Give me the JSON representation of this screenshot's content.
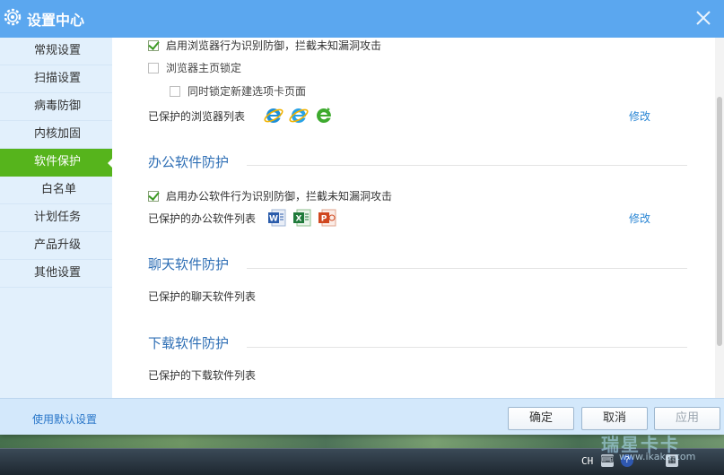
{
  "window": {
    "title": "设置中心"
  },
  "sidebar": {
    "items": [
      {
        "label": "常规设置",
        "active": false
      },
      {
        "label": "扫描设置",
        "active": false
      },
      {
        "label": "病毒防御",
        "active": false
      },
      {
        "label": "内核加固",
        "active": false
      },
      {
        "label": "软件保护",
        "active": true
      },
      {
        "label": "白名单",
        "active": false
      },
      {
        "label": "计划任务",
        "active": false
      },
      {
        "label": "产品升级",
        "active": false
      },
      {
        "label": "其他设置",
        "active": false
      }
    ]
  },
  "browser": {
    "enable_label": "启用浏览器行为识别防御，拦截未知漏洞攻击",
    "enable_checked": true,
    "homepage_lock_label": "浏览器主页锁定",
    "homepage_lock_checked": false,
    "newtab_lock_label": "同时锁定新建选项卡页面",
    "newtab_lock_checked": false,
    "protected_list_label": "已保护的浏览器列表",
    "edit_label": "修改",
    "icons": [
      "ie-icon",
      "ie-icon",
      "ie-green-icon"
    ]
  },
  "office": {
    "section_title": "办公软件防护",
    "enable_label": "启用办公软件行为识别防御，拦截未知漏洞攻击",
    "enable_checked": true,
    "protected_list_label": "已保护的办公软件列表",
    "edit_label": "修改",
    "icons": [
      "word-icon",
      "excel-icon",
      "powerpoint-icon"
    ]
  },
  "chat": {
    "section_title": "聊天软件防护",
    "protected_list_label": "已保护的聊天软件列表"
  },
  "download": {
    "section_title": "下载软件防护",
    "protected_list_label": "已保护的下载软件列表"
  },
  "footer": {
    "default_link": "使用默认设置",
    "ok_label": "确定",
    "cancel_label": "取消",
    "apply_label": "应用"
  },
  "taskbar": {
    "lang": "CH"
  },
  "watermark": {
    "text": "瑞星卡卡",
    "url": "www.ikaka.com"
  },
  "colors": {
    "titlebar": "#5ba7ef",
    "active_nav": "#56b41c",
    "section_title": "#2f6fb5",
    "link": "#2a86d4"
  }
}
